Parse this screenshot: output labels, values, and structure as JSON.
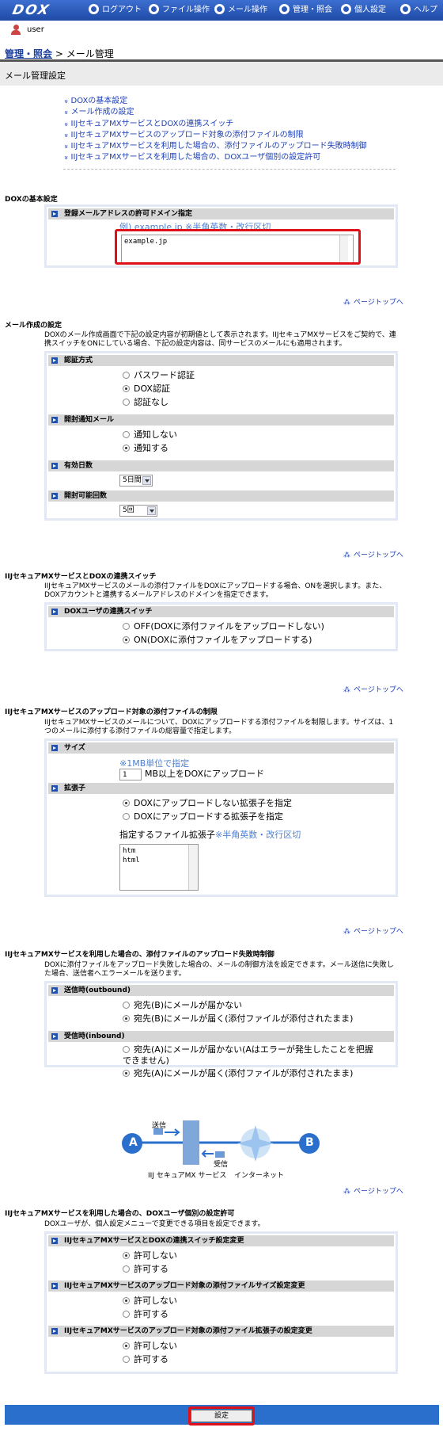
{
  "nav": {
    "logo": "DOX",
    "items": [
      "ログアウト",
      "ファイル操作",
      "メール操作",
      "管理・照会",
      "個人設定",
      "ヘルプ"
    ]
  },
  "user": {
    "name": "user"
  },
  "breadcrumb": {
    "link": "管理・照会",
    "separator": " > ",
    "current": "メール管理"
  },
  "page_title": "メール管理設定",
  "toc": [
    "DOXの基本設定",
    "メール作成の設定",
    "IIJセキュアMXサービスとDOXの連携スイッチ",
    "IIJセキュアMXサービスのアップロード対象の添付ファイルの制限",
    "IIJセキュアMXサービスを利用した場合の、添付ファイルのアップロード失敗時制御",
    "IIJセキュアMXサービスを利用した場合の、DOXユーザ個別の設定許可"
  ],
  "pagetop": "ページトップへ",
  "s1": {
    "title": "DOXの基本設定",
    "hdr": "登録メールアドレスの許可ドメイン指定",
    "note": "例) example.jp ※半角英数・改行区切",
    "value": "example.jp"
  },
  "s2": {
    "title": "メール作成の設定",
    "desc": "DOXのメール作成画面で下記の設定内容が初期値として表示されます。IIJセキュアMXサービスをご契約で、連携スイッチをONにしている場合、下記の設定内容は、同サービスのメールにも適用されます。",
    "auth": {
      "hdr": "認証方式",
      "opts": [
        "パスワード認証",
        "DOX認証",
        "認証なし"
      ],
      "selected": 1
    },
    "notify": {
      "hdr": "開封通知メール",
      "opts": [
        "通知しない",
        "通知する"
      ],
      "selected": 1
    },
    "days": {
      "hdr": "有効日数",
      "value": "5日間"
    },
    "count": {
      "hdr": "開封可能回数",
      "value": "5回"
    }
  },
  "s3": {
    "title": "IIJセキュアMXサービスとDOXの連携スイッチ",
    "desc": "IIJセキュアMXサービスのメールの添付ファイルをDOXにアップロードする場合、ONを選択します。また、DOXアカウントと連携するメールアドレスのドメインを指定できます。",
    "hdr": "DOXユーザの連携スイッチ",
    "opts": [
      "OFF(DOXに添付ファイルをアップロードしない)",
      "ON(DOXに添付ファイルをアップロードする)"
    ],
    "selected": 1
  },
  "s4": {
    "title": "IIJセキュアMXサービスのアップロード対象の添付ファイルの制限",
    "desc": "IIJセキュアMXサービスのメールについて、DOXにアップロードする添付ファイルを制限します。サイズは、1つのメールに添付する添付ファイルの総容量で指定します。",
    "size": {
      "hdr": "サイズ",
      "note": "※1MB単位で指定",
      "value": "1",
      "suffix": "MB以上をDOXにアップロード"
    },
    "ext": {
      "hdr": "拡張子",
      "opts": [
        "DOXにアップロードしない拡張子を指定",
        "DOXにアップロードする拡張子を指定"
      ],
      "selected": 0,
      "label": "指定するファイル拡張子",
      "note": "※半角英数・改行区切",
      "value": "htm\nhtml"
    }
  },
  "s5": {
    "title": "IIJセキュアMXサービスを利用した場合の、添付ファイルのアップロード失敗時制御",
    "desc": "DOXに添付ファイルをアップロード失敗した場合の、メールの制御方法を設定できます。メール送信に失敗した場合、送信者へエラーメールを送ります。",
    "out": {
      "hdr": "送信時(outbound)",
      "opts": [
        "宛先(B)にメールが届かない",
        "宛先(B)にメールが届く(添付ファイルが添付されたまま)"
      ],
      "selected": 1
    },
    "in": {
      "hdr": "受信時(inbound)",
      "opts": [
        "宛先(A)にメールが届かない(Aはエラーが発生したことを把握できません)",
        "宛先(A)にメールが届く(添付ファイルが添付されたまま)"
      ],
      "selected": 1
    }
  },
  "diagram": {
    "a": "A",
    "b": "B",
    "send": "送信",
    "recv": "受信",
    "mx": "IIJ セキュアMX サービス",
    "net": "インターネット"
  },
  "s6": {
    "title": "IIJセキュアMXサービスを利用した場合の、DOXユーザ個別の設定許可",
    "desc": "DOXユーザが、個人設定メニューで変更できる項目を設定できます。",
    "g1": {
      "hdr": "IIJセキュアMXサービスとDOXの連携スイッチ設定変更",
      "opts": [
        "許可しない",
        "許可する"
      ],
      "selected": 0
    },
    "g2": {
      "hdr": "IIJセキュアMXサービスのアップロード対象の添付ファイルサイズ設定変更",
      "opts": [
        "許可しない",
        "許可する"
      ],
      "selected": 0
    },
    "g3": {
      "hdr": "IIJセキュアMXサービスのアップロード対象の添付ファイル拡張子の設定変更",
      "opts": [
        "許可しない",
        "許可する"
      ],
      "selected": 0
    }
  },
  "submit": "設定",
  "colors": {
    "accent": "#2a6fcc",
    "highlight": "#e0101a"
  }
}
